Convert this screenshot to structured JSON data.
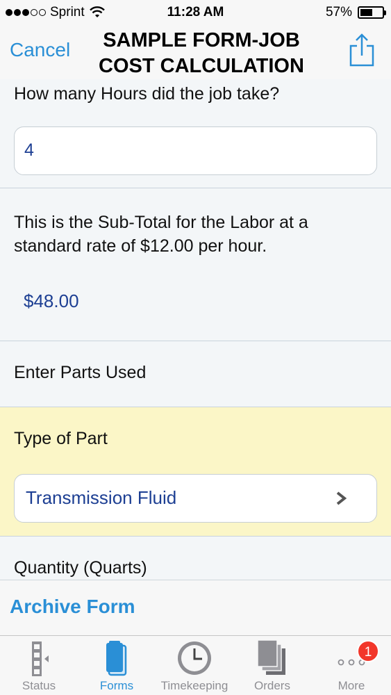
{
  "status_bar": {
    "carrier": "Sprint",
    "time": "11:28 AM",
    "battery": "57%",
    "battery_level": 0.57
  },
  "nav": {
    "cancel_label": "Cancel",
    "title_line1": "SAMPLE FORM-JOB",
    "title_line2": "COST CALCULATION",
    "share_icon": "share-icon"
  },
  "form": {
    "hours": {
      "label": "How many Hours did the job take?",
      "value": "4"
    },
    "labor_subtotal": {
      "label_line1": "This is the Sub-Total for the Labor at a",
      "label_line2": "standard rate of $12.00 per hour.",
      "value": "$48.00"
    },
    "parts_header": {
      "label": "Enter Parts Used"
    },
    "part_type": {
      "label": "Type of Part",
      "value": "Transmission Fluid",
      "highlight_color": "#fbf6c7"
    },
    "quantity": {
      "label": "Quantity (Quarts)"
    }
  },
  "archive": {
    "label": "Archive Form"
  },
  "tabs": [
    {
      "label": "Status",
      "icon": "status-icon",
      "active": false
    },
    {
      "label": "Forms",
      "icon": "forms-icon",
      "active": true
    },
    {
      "label": "Timekeeping",
      "icon": "clock-icon",
      "active": false
    },
    {
      "label": "Orders",
      "icon": "orders-icon",
      "active": false
    },
    {
      "label": "More",
      "icon": "more-icon",
      "active": false,
      "badge": "1"
    }
  ],
  "colors": {
    "accent": "#2a8fd6",
    "value_text": "#1d3f93",
    "badge": "#f2362a"
  }
}
